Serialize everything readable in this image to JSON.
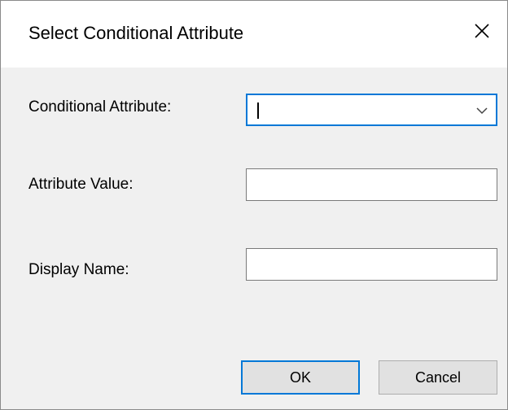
{
  "dialog": {
    "title": "Select Conditional Attribute",
    "close_icon": "close-icon"
  },
  "form": {
    "conditional_attribute": {
      "label": "Conditional Attribute:",
      "value": "",
      "dropdown_icon": "chevron-down-icon"
    },
    "attribute_value": {
      "label": "Attribute Value:",
      "value": ""
    },
    "display_name": {
      "label": "Display Name:",
      "value": ""
    }
  },
  "buttons": {
    "ok": "OK",
    "cancel": "Cancel"
  },
  "colors": {
    "accent": "#0078d7",
    "dialog_background": "#f0f0f0",
    "titlebar_background": "#ffffff"
  }
}
